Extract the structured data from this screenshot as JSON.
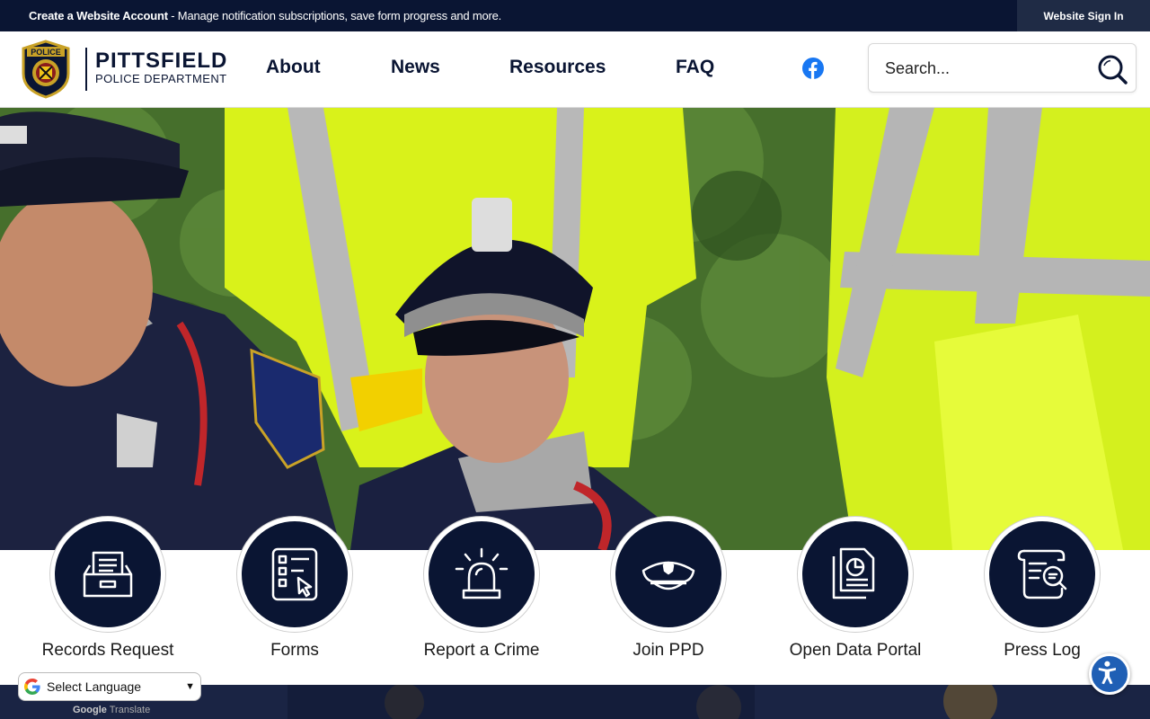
{
  "topbar": {
    "create_account": "Create a Website Account",
    "message": " - Manage notification subscriptions, save form progress and more.",
    "sign_in": "Website Sign In"
  },
  "header": {
    "logo_title": "PITTSFIELD",
    "logo_subtitle": "POLICE DEPARTMENT",
    "nav": [
      "About",
      "News",
      "Resources",
      "FAQ"
    ],
    "search_placeholder": "Search..."
  },
  "quick_links": [
    {
      "label": "Records Request",
      "icon": "inbox-tray-icon"
    },
    {
      "label": "Forms",
      "icon": "checklist-form-icon"
    },
    {
      "label": "Report a Crime",
      "icon": "siren-light-icon"
    },
    {
      "label": "Join PPD",
      "icon": "police-cap-icon"
    },
    {
      "label": "Open Data Portal",
      "icon": "data-report-icon"
    },
    {
      "label": "Press Log",
      "icon": "scroll-search-icon"
    }
  ],
  "translate": {
    "select_label": "Select Language",
    "powered_google": "Google",
    "powered_translate": "Translate"
  },
  "colors": {
    "navy": "#0a1533",
    "facebook": "#1877f2",
    "accessibility": "#1f5fb5"
  }
}
